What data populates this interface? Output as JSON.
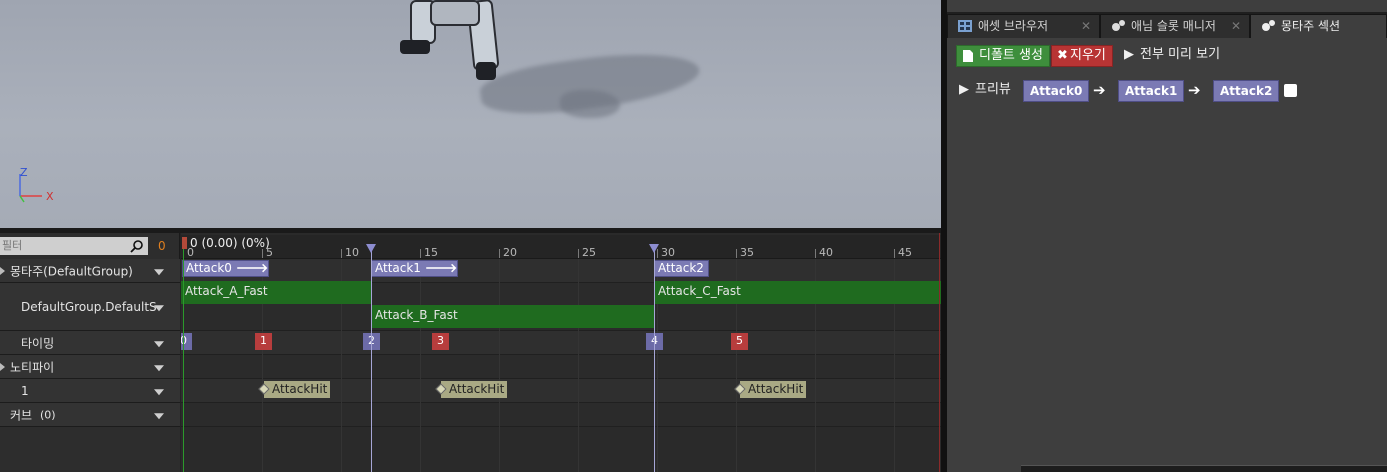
{
  "viewport": {
    "axis": {
      "x_label": "X",
      "z_label": "Z"
    }
  },
  "sequencer": {
    "filter_placeholder": "필터",
    "current_frame": "0",
    "time_readout": "0 (0.00) (0%)",
    "ruler_ticks": [
      "0",
      "5",
      "10",
      "15",
      "20",
      "25",
      "30",
      "35",
      "40",
      "45"
    ],
    "tracks": {
      "montage": "몽타주(DefaultGroup)",
      "slot": "DefaultGroup.DefaultS",
      "timing": "타이밍",
      "notify": "노티파이",
      "notify_track": "1",
      "curve": "커브",
      "curve_count": "(0)"
    },
    "sections": [
      {
        "name": "Attack0",
        "arrow": "🡒"
      },
      {
        "name": "Attack1",
        "arrow": "🡒"
      },
      {
        "name": "Attack2",
        "arrow": ""
      }
    ],
    "anim_segments": [
      "Attack_A_Fast",
      "Attack_B_Fast",
      "Attack_C_Fast"
    ],
    "timing_markers": [
      {
        "label": "0",
        "color": "blue"
      },
      {
        "label": "1",
        "color": "red"
      },
      {
        "label": "2",
        "color": "blue"
      },
      {
        "label": "3",
        "color": "red"
      },
      {
        "label": "4",
        "color": "blue"
      },
      {
        "label": "5",
        "color": "red"
      }
    ],
    "notifies": [
      "AttackHit",
      "AttackHit",
      "AttackHit"
    ]
  },
  "right_panel": {
    "tabs": [
      {
        "label": "애셋 브라우저",
        "icon": "asset-browser-icon",
        "close": "✕"
      },
      {
        "label": "애님 슬롯 매니저",
        "icon": "slot-manager-icon",
        "close": "✕"
      },
      {
        "label": "몽타주 섹션",
        "icon": "montage-section-icon",
        "close": ""
      }
    ],
    "buttons": {
      "create_default": "디폴트 생성",
      "clear": "지우기",
      "preview_all": "전부 미리 보기"
    },
    "preview_label": "프리뷰",
    "section_chain": [
      "Attack0",
      "Attack1",
      "Attack2"
    ]
  },
  "colors": {
    "section_purple": "#7b7ab4",
    "anim_green": "#1f6b1f",
    "timing_red": "#b73d3d",
    "notify_tan": "#a9a984",
    "frame_orange": "#e07f1f"
  }
}
